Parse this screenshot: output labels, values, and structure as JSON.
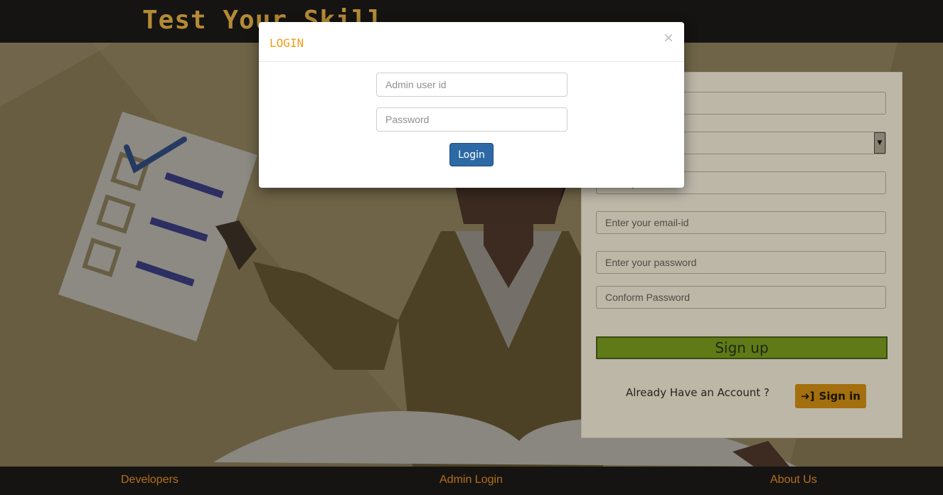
{
  "header": {
    "brand_text": "Test Your Skill"
  },
  "footer": {
    "links": [
      "Developers",
      "Admin Login",
      "About Us"
    ]
  },
  "signup_form": {
    "fields": [
      {
        "placeholder": ""
      },
      {
        "placeholder": ""
      },
      {
        "placeholder": "Enter your name"
      },
      {
        "placeholder": "Enter your email-id"
      },
      {
        "placeholder": "Enter your password"
      },
      {
        "placeholder": "Conform Password"
      }
    ],
    "signup_label": "Sign up",
    "already_text": "Already Have an Account ?",
    "signin_label": "Sign in"
  },
  "modal": {
    "title": "LOGIN",
    "close_label": "×",
    "user_placeholder": "Admin user id",
    "password_placeholder": "Password",
    "login_label": "Login"
  }
}
